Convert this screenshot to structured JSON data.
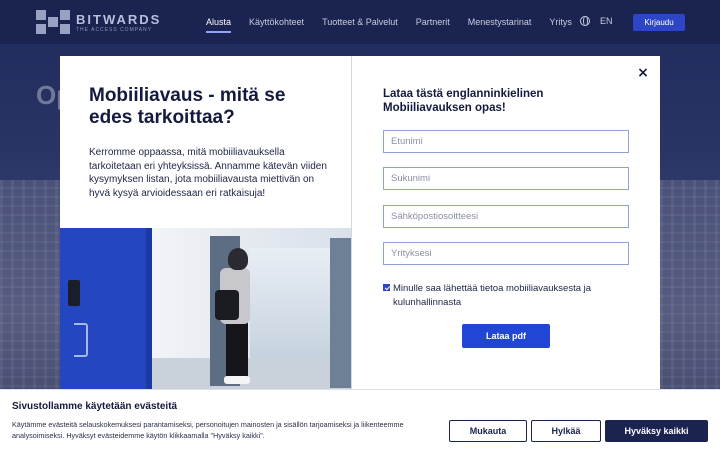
{
  "nav": {
    "logo_name": "BITWARDS",
    "logo_tagline": "THE ACCESS COMPANY",
    "links": [
      "Alusta",
      "Käyttökohteet",
      "Tuotteet & Palvelut",
      "Partnerit",
      "Menestystarinat",
      "Yritys"
    ],
    "active_link": "Alusta",
    "language": "EN",
    "login_label": "Kirjaudu"
  },
  "hero": {
    "title_fragment": "Op"
  },
  "modal": {
    "title": "Mobiiliavaus - mitä se edes tarkoittaa?",
    "description": "Kerromme oppaassa, mitä mobiiliavauksella tarkoitetaan eri yhteyksissä. Annamme kätevän viiden kysymyksen listan, jota mobiiliavausta miettivän on hyvä kysyä arvioidessaan eri ratkaisuja!",
    "form_title": "Lataa tästä englanninkielinen Mobiiliavauksen opas!",
    "fields": {
      "first_name_placeholder": "Etunimi",
      "last_name_placeholder": "Sukunimi",
      "email_placeholder": "Sähköpostiosoitteesi",
      "company_placeholder": "Yrityksesi"
    },
    "consent_label": "Minulle saa lähettää tietoa mobiiliavauksesta ja kulunhallinnasta",
    "consent_checked": true,
    "submit_label": "Lataa pdf",
    "close_icon": "×"
  },
  "cookie": {
    "title": "Sivustollamme käytetään evästeitä",
    "text": "Käytämme evästeitä selauskokemuksesi parantamiseksi, personoitujen mainosten ja sisällön tarjoamiseksi ja liikenteemme analysoimiseksi. Hyväksyt evästeidemme käytön klikkaamalla \"Hyväksy kaikki\".",
    "customize_label": "Mukauta",
    "reject_label": "Hylkää",
    "accept_label": "Hyväksy kaikki"
  },
  "colors": {
    "nav_bg": "#1b2350",
    "accent": "#2146d6",
    "door_blue": "#2446c0"
  }
}
